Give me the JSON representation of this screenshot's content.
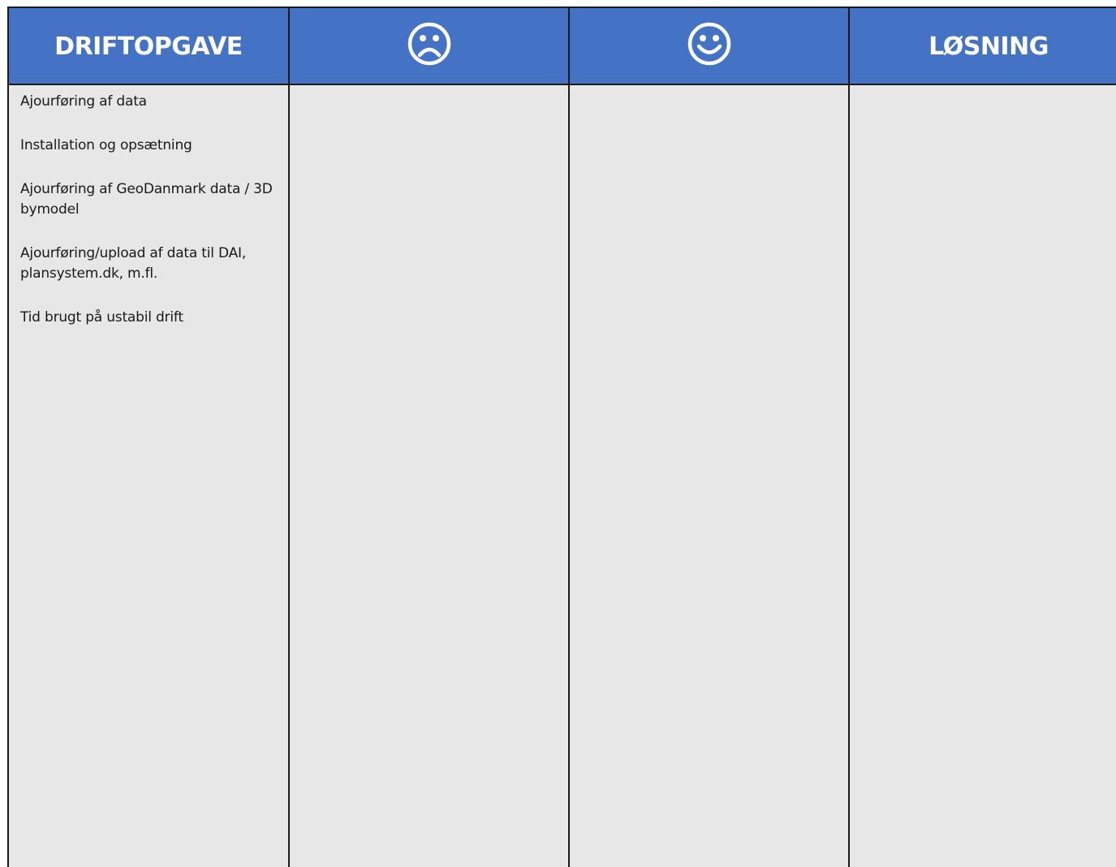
{
  "header": {
    "col1_title": "DRIFTOPGAVE",
    "col2_icon": "sad-face-icon",
    "col3_icon": "happy-face-icon",
    "col4_title": "LØSNING"
  },
  "colors": {
    "header_bg": "#4472c4",
    "cell_bg": "#e7e7e7",
    "border": "#1a1a1a"
  },
  "tasks": [
    "Ajourføring af data",
    "Installation og opsætning",
    "Ajourføring af GeoDanmark data / 3D bymodel",
    "Ajourføring/upload af data til DAI, plansystem.dk, m.fl.",
    "Tid brugt på ustabil drift"
  ]
}
